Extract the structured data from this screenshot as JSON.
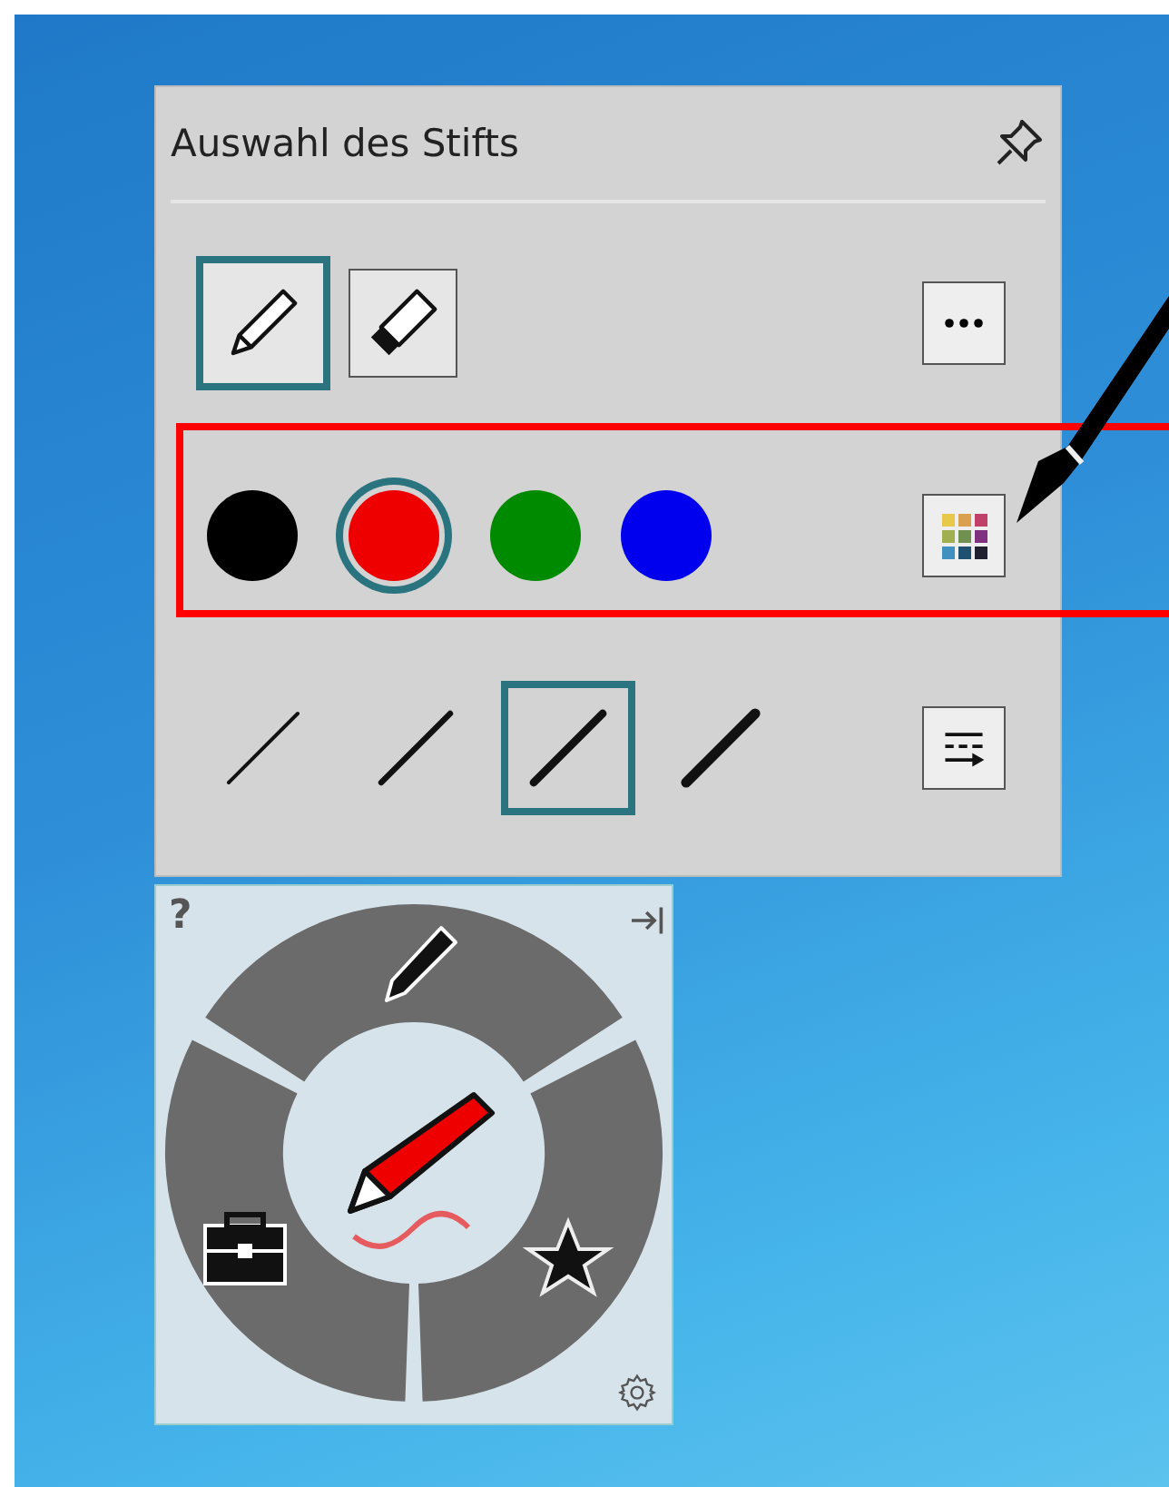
{
  "panel": {
    "title": "Auswahl des Stifts"
  },
  "pen_types": [
    {
      "kind": "pen",
      "selected": true
    },
    {
      "kind": "highlighter",
      "selected": false
    }
  ],
  "colors": [
    {
      "color": "#000000",
      "selected": false
    },
    {
      "color": "#ee0000",
      "selected": true
    },
    {
      "color": "#008a00",
      "selected": false
    },
    {
      "color": "#0000ee",
      "selected": false
    }
  ],
  "widths": [
    {
      "selected": false
    },
    {
      "selected": false
    },
    {
      "selected": true
    },
    {
      "selected": false
    }
  ],
  "wheel": {
    "help": "?"
  }
}
